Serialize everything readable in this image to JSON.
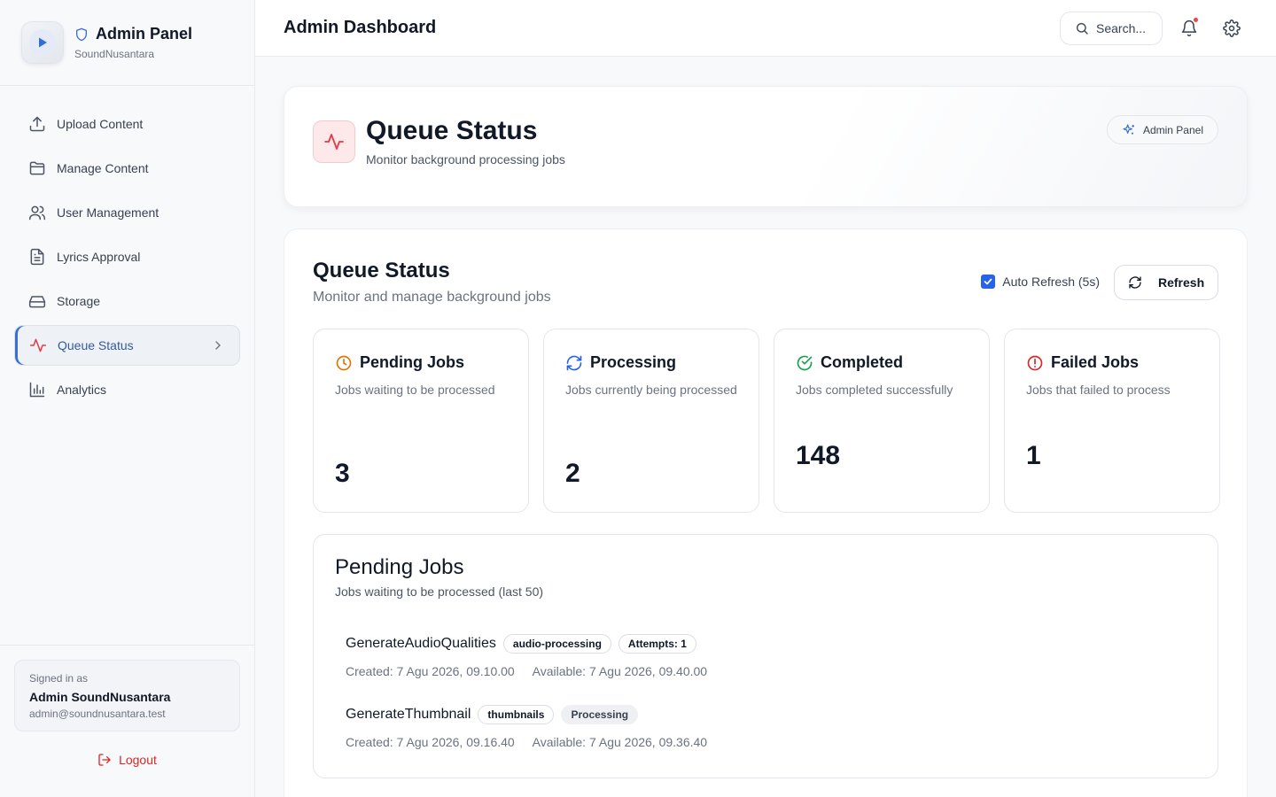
{
  "sidebar": {
    "brand_title": "Admin Panel",
    "brand_subtitle": "SoundNusantara",
    "items": [
      {
        "label": "Upload Content",
        "icon": "upload-icon"
      },
      {
        "label": "Manage Content",
        "icon": "folder-icon"
      },
      {
        "label": "User Management",
        "icon": "users-icon"
      },
      {
        "label": "Lyrics Approval",
        "icon": "document-icon"
      },
      {
        "label": "Storage",
        "icon": "storage-icon"
      },
      {
        "label": "Queue Status",
        "icon": "activity-icon",
        "active": true
      },
      {
        "label": "Analytics",
        "icon": "bar-chart-icon"
      }
    ],
    "signed_in_label": "Signed in as",
    "user_name": "Admin SoundNusantara",
    "user_email": "admin@soundnusantara.test",
    "logout_label": "Logout"
  },
  "header": {
    "title": "Admin Dashboard",
    "search_placeholder": "Search..."
  },
  "hero": {
    "title": "Queue Status",
    "subtitle": "Monitor background processing jobs",
    "badge": "Admin Panel"
  },
  "panel": {
    "title": "Queue Status",
    "subtitle": "Monitor and manage background jobs",
    "auto_refresh_label": "Auto Refresh (5s)",
    "auto_refresh_checked": true,
    "refresh_label": "Refresh"
  },
  "stats": [
    {
      "title": "Pending Jobs",
      "desc": "Jobs waiting to be processed",
      "value": "3",
      "icon": "clock-icon",
      "color": "#d97706"
    },
    {
      "title": "Processing",
      "desc": "Jobs currently being processed",
      "value": "2",
      "icon": "refresh-icon",
      "color": "#2563eb"
    },
    {
      "title": "Completed",
      "desc": "Jobs completed successfully",
      "value": "148",
      "icon": "check-circle-icon",
      "color": "#16a34a"
    },
    {
      "title": "Failed Jobs",
      "desc": "Jobs that failed to process",
      "value": "1",
      "icon": "alert-circle-icon",
      "color": "#dc2626"
    }
  ],
  "pending": {
    "title": "Pending Jobs",
    "subtitle": "Jobs waiting to be processed (last 50)",
    "jobs": [
      {
        "name": "GenerateAudioQualities",
        "queue": "audio-processing",
        "status": "Attempts: 1",
        "created": "Created: 7 Agu 2026, 09.10.00",
        "available": "Available: 7 Agu 2026, 09.40.00"
      },
      {
        "name": "GenerateThumbnail",
        "queue": "thumbnails",
        "status": "Processing",
        "created": "Created: 7 Agu 2026, 09.16.40",
        "available": "Available: 7 Agu 2026, 09.36.40"
      }
    ]
  },
  "colors": {
    "accent": "#2563eb",
    "active_nav": "#375a9e",
    "danger": "#dc2626"
  }
}
